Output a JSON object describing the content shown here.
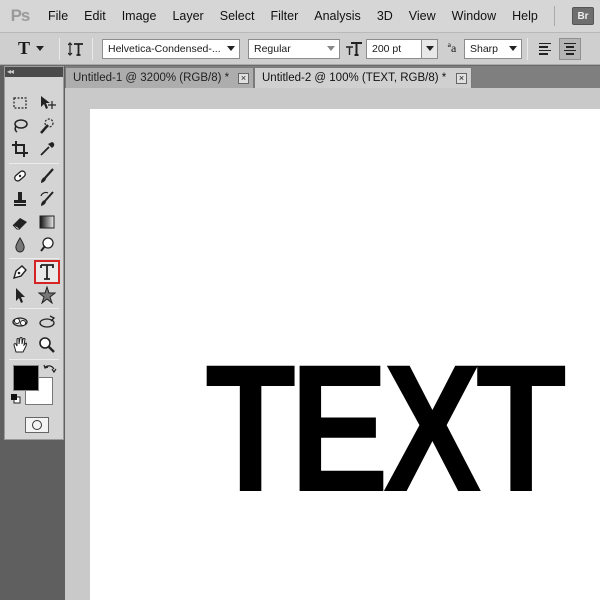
{
  "app": {
    "logo": "Ps"
  },
  "menu": [
    "File",
    "Edit",
    "Image",
    "Layer",
    "Select",
    "Filter",
    "Analysis",
    "3D",
    "View",
    "Window",
    "Help"
  ],
  "bridge_button": "Br",
  "options": {
    "tool_glyph": "T",
    "orient_glyph": "↕T",
    "font_family": "Helvetica-Condensed-...",
    "font_style": "Regular",
    "size_glyph": "T",
    "font_size": "200 pt",
    "aa_glyph": "ªa",
    "antialias": "Sharp"
  },
  "toolbox": {
    "header": "◂◂",
    "selected_tool": "horizontal-type-tool"
  },
  "tabs": [
    {
      "label": "Untitled-1 @ 3200% (RGB/8) *",
      "close": "×"
    },
    {
      "label": "Untitled-2 @ 100% (TEXT, RGB/8) *",
      "close": "×"
    }
  ],
  "canvas": {
    "text": "TEXT"
  },
  "colors": {
    "foreground": "#000000",
    "background": "#ffffff",
    "selection_highlight": "#d62323"
  }
}
